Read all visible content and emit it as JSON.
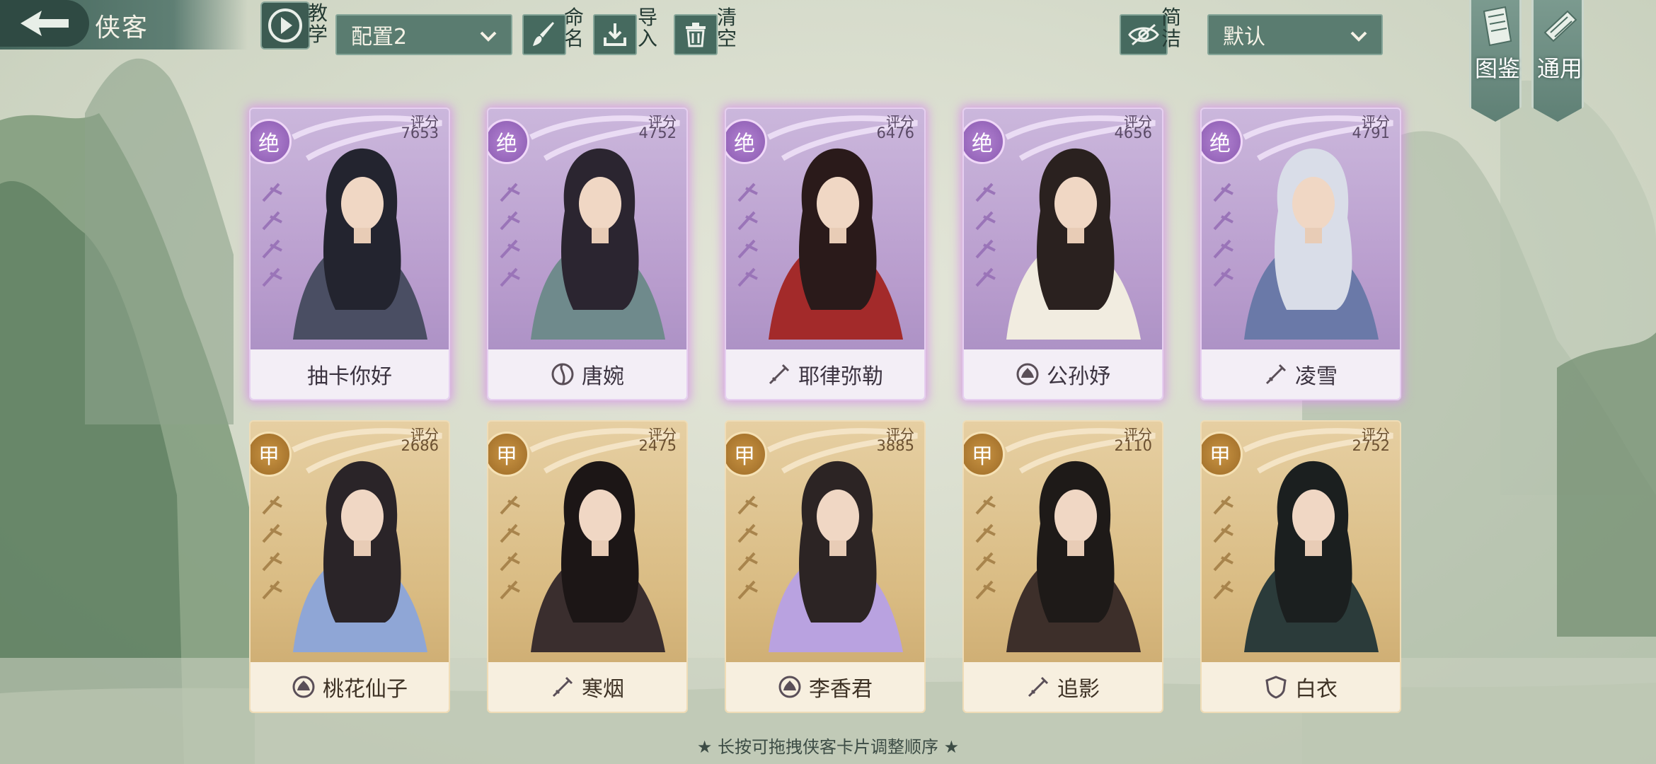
{
  "header": {
    "title": "侠客",
    "tutorial_label": "教学",
    "config_select": "配置2",
    "rename_label": "命名",
    "import_label": "导入",
    "clear_label": "清空",
    "simple_label": "简洁",
    "sort_select": "默认",
    "codex_label": "图鉴",
    "general_label": "通用"
  },
  "score_label": "评分",
  "cards": [
    {
      "rank": "绝",
      "score": "7653",
      "name": "抽卡你好",
      "class_icon": "none-icon",
      "tier": "purple"
    },
    {
      "rank": "绝",
      "score": "4752",
      "name": "唐婉",
      "class_icon": "taiji-icon",
      "tier": "purple"
    },
    {
      "rank": "绝",
      "score": "6476",
      "name": "耶律弥勒",
      "class_icon": "sword-icon",
      "tier": "purple"
    },
    {
      "rank": "绝",
      "score": "4656",
      "name": "公孙妤",
      "class_icon": "lotus-icon",
      "tier": "purple"
    },
    {
      "rank": "绝",
      "score": "4791",
      "name": "凌雪",
      "class_icon": "sword-icon",
      "tier": "purple"
    },
    {
      "rank": "甲",
      "score": "2686",
      "name": "桃花仙子",
      "class_icon": "lotus-icon",
      "tier": "gold"
    },
    {
      "rank": "甲",
      "score": "2475",
      "name": "寒烟",
      "class_icon": "sword-icon",
      "tier": "gold"
    },
    {
      "rank": "甲",
      "score": "3885",
      "name": "李香君",
      "class_icon": "lotus-icon",
      "tier": "gold"
    },
    {
      "rank": "甲",
      "score": "2110",
      "name": "追影",
      "class_icon": "sword-icon",
      "tier": "gold"
    },
    {
      "rank": "甲",
      "score": "2752",
      "name": "白衣",
      "class_icon": "shield-icon",
      "tier": "gold"
    }
  ],
  "footer_hint": "★ 长按可拖拽侠客卡片调整顺序 ★"
}
